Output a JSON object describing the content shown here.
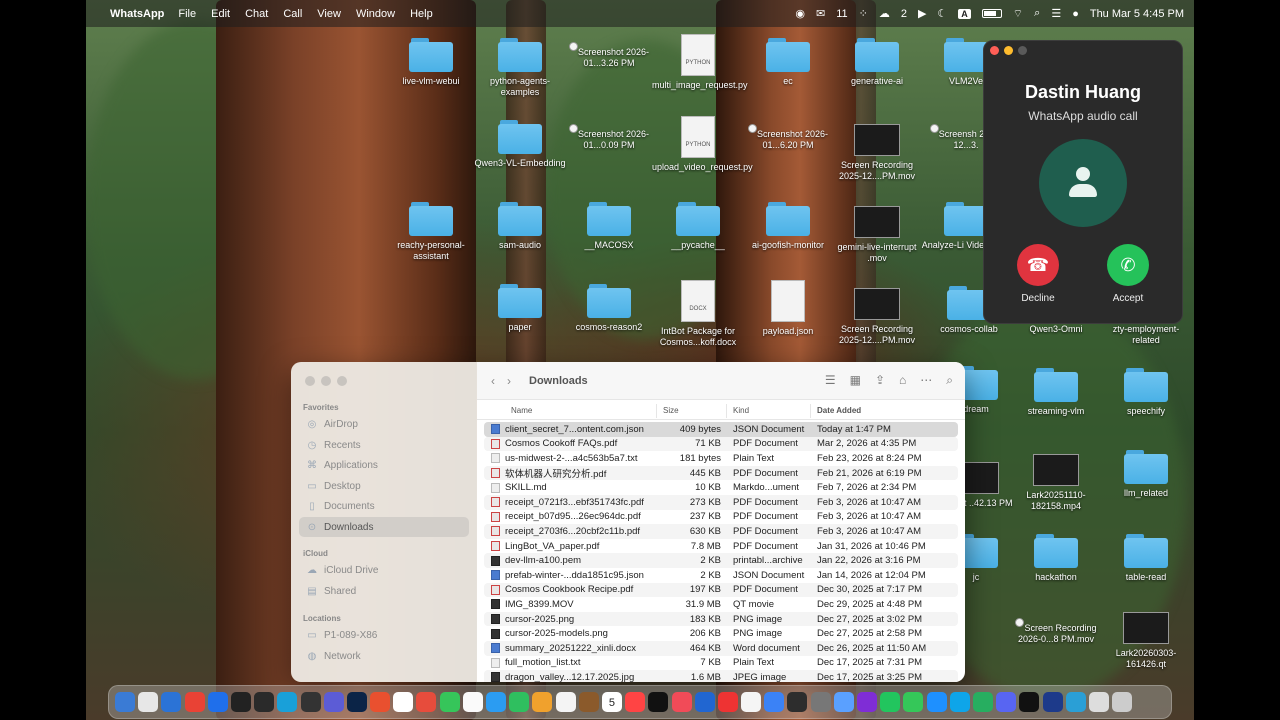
{
  "menubar": {
    "app_name": "WhatsApp",
    "menus": [
      "File",
      "Edit",
      "Chat",
      "Call",
      "View",
      "Window",
      "Help"
    ],
    "wechat_count": "11",
    "cloud_count": "2",
    "input_source": "A",
    "clock": "Thu Mar 5  4:45 PM"
  },
  "desktop_icons": [
    {
      "label": "live-vlm-webui",
      "type": "folder"
    },
    {
      "label": "python-agents-examples",
      "type": "folder"
    },
    {
      "label": "Screenshot 2026-01...3.26 PM",
      "type": "thumb"
    },
    {
      "label": "multi_image_request.py",
      "type": "doc",
      "badge": "PYTHON"
    },
    {
      "label": "ec",
      "type": "folder"
    },
    {
      "label": "generative-ai",
      "type": "folder"
    },
    {
      "label": "VLM2Ve",
      "type": "folder"
    },
    {
      "label": "Qwen3-VL-Embedding",
      "type": "folder"
    },
    {
      "label": "Screenshot 2026-01...0.09 PM",
      "type": "thumb-light"
    },
    {
      "label": "upload_video_request.py",
      "type": "doc",
      "badge": "PYTHON"
    },
    {
      "label": "Screenshot 2026-01...6.20 PM",
      "type": "thumb-light"
    },
    {
      "label": "Screen Recording 2025-12....PM.mov",
      "type": "thumb"
    },
    {
      "label": "Screensh 2025-12...3.",
      "type": "thumb-light"
    },
    {
      "label": "reachy-personal-assistant",
      "type": "folder"
    },
    {
      "label": "sam-audio",
      "type": "folder"
    },
    {
      "label": "__MACOSX",
      "type": "folder"
    },
    {
      "label": "__pycache__",
      "type": "folder"
    },
    {
      "label": "ai-goofish-monitor",
      "type": "folder"
    },
    {
      "label": "gemini-live-interrupt .mov",
      "type": "thumb"
    },
    {
      "label": "Analyze-Li Video-Solu",
      "type": "folder"
    },
    {
      "label": "paper",
      "type": "folder"
    },
    {
      "label": "cosmos-reason2",
      "type": "folder"
    },
    {
      "label": "IntBot Package for Cosmos...koff.docx",
      "type": "doc",
      "badge": "DOCX"
    },
    {
      "label": "payload.json",
      "type": "doc",
      "badge": ""
    },
    {
      "label": "Screen Recording 2025-12....PM.mov",
      "type": "thumb"
    },
    {
      "label": "cosmos-collab",
      "type": "folder"
    },
    {
      "label": "Qwen3-Omni",
      "type": "folder"
    },
    {
      "label": "zty-employment-related",
      "type": "folder"
    },
    {
      "label": "dream",
      "type": "folder"
    },
    {
      "label": "streaming-vlm",
      "type": "folder"
    },
    {
      "label": "speechify",
      "type": "folder"
    },
    {
      "label": "enshot ..42.13 PM",
      "type": "thumb"
    },
    {
      "label": "Lark20251110-182158.mp4",
      "type": "thumb"
    },
    {
      "label": "llm_related",
      "type": "folder"
    },
    {
      "label": "jc",
      "type": "folder"
    },
    {
      "label": "hackathon",
      "type": "folder"
    },
    {
      "label": "table-read",
      "type": "folder"
    },
    {
      "label": "Screen Recording 2026-0...8 PM.mov",
      "type": "thumb-light"
    },
    {
      "label": "Lark20260303-161426.qt",
      "type": "thumb"
    }
  ],
  "call": {
    "caller": "Dastin Huang",
    "subtitle": "WhatsApp audio call",
    "decline_label": "Decline",
    "accept_label": "Accept",
    "decline_color": "#e0343f",
    "accept_color": "#25c25a"
  },
  "finder": {
    "title": "Downloads",
    "sidebar": {
      "favorites_label": "Favorites",
      "favorites": [
        "AirDrop",
        "Recents",
        "Applications",
        "Desktop",
        "Documents",
        "Downloads"
      ],
      "icloud_label": "iCloud",
      "icloud": [
        "iCloud Drive",
        "Shared"
      ],
      "locations_label": "Locations",
      "locations": [
        "P1-089-X86",
        "Network"
      ]
    },
    "columns": {
      "name": "Name",
      "size": "Size",
      "kind": "Kind",
      "date": "Date Added"
    },
    "rows": [
      {
        "name": "client_secret_7...ontent.com.json",
        "size": "409 bytes",
        "kind": "JSON Document",
        "date": "Today at 1:47 PM"
      },
      {
        "name": "Cosmos Cookoff FAQs.pdf",
        "size": "71 KB",
        "kind": "PDF Document",
        "date": "Mar 2, 2026 at 4:35 PM"
      },
      {
        "name": "us-midwest-2-...a4c563b5a7.txt",
        "size": "181 bytes",
        "kind": "Plain Text",
        "date": "Feb 23, 2026 at 8:24 PM"
      },
      {
        "name": "软体机器人研究分析.pdf",
        "size": "445 KB",
        "kind": "PDF Document",
        "date": "Feb 21, 2026 at 6:19 PM"
      },
      {
        "name": "SKILL.md",
        "size": "10 KB",
        "kind": "Markdo...ument",
        "date": "Feb 7, 2026 at 2:34 PM"
      },
      {
        "name": "receipt_0721f3...ebf351743fc.pdf",
        "size": "273 KB",
        "kind": "PDF Document",
        "date": "Feb 3, 2026 at 10:47 AM"
      },
      {
        "name": "receipt_b07d95...26ec964dc.pdf",
        "size": "237 KB",
        "kind": "PDF Document",
        "date": "Feb 3, 2026 at 10:47 AM"
      },
      {
        "name": "receipt_2703f6...20cbf2c11b.pdf",
        "size": "630 KB",
        "kind": "PDF Document",
        "date": "Feb 3, 2026 at 10:47 AM"
      },
      {
        "name": "LingBot_VA_paper.pdf",
        "size": "7.8 MB",
        "kind": "PDF Document",
        "date": "Jan 31, 2026 at 10:46 PM"
      },
      {
        "name": "dev-llm-a100.pem",
        "size": "2 KB",
        "kind": "printabl...archive",
        "date": "Jan 22, 2026 at 3:16 PM"
      },
      {
        "name": "prefab-winter-...dda1851c95.json",
        "size": "2 KB",
        "kind": "JSON Document",
        "date": "Jan 14, 2026 at 12:04 PM"
      },
      {
        "name": "Cosmos Cookbook Recipe.pdf",
        "size": "197 KB",
        "kind": "PDF Document",
        "date": "Dec 30, 2025 at 7:17 PM"
      },
      {
        "name": "IMG_8399.MOV",
        "size": "31.9 MB",
        "kind": "QT movie",
        "date": "Dec 29, 2025 at 4:48 PM"
      },
      {
        "name": "cursor-2025.png",
        "size": "183 KB",
        "kind": "PNG image",
        "date": "Dec 27, 2025 at 3:02 PM"
      },
      {
        "name": "cursor-2025-models.png",
        "size": "206 KB",
        "kind": "PNG image",
        "date": "Dec 27, 2025 at 2:58 PM"
      },
      {
        "name": "summary_20251222_xinli.docx",
        "size": "464 KB",
        "kind": "Word document",
        "date": "Dec 26, 2025 at 11:50 AM"
      },
      {
        "name": "full_motion_list.txt",
        "size": "7 KB",
        "kind": "Plain Text",
        "date": "Dec 17, 2025 at 7:31 PM"
      },
      {
        "name": "dragon_valley...12.17.2025.jpg",
        "size": "1.6 MB",
        "kind": "JPEG image",
        "date": "Dec 17, 2025 at 3:25 PM"
      }
    ]
  },
  "dock": {
    "icon_count": 44,
    "calendar_day": "5"
  }
}
